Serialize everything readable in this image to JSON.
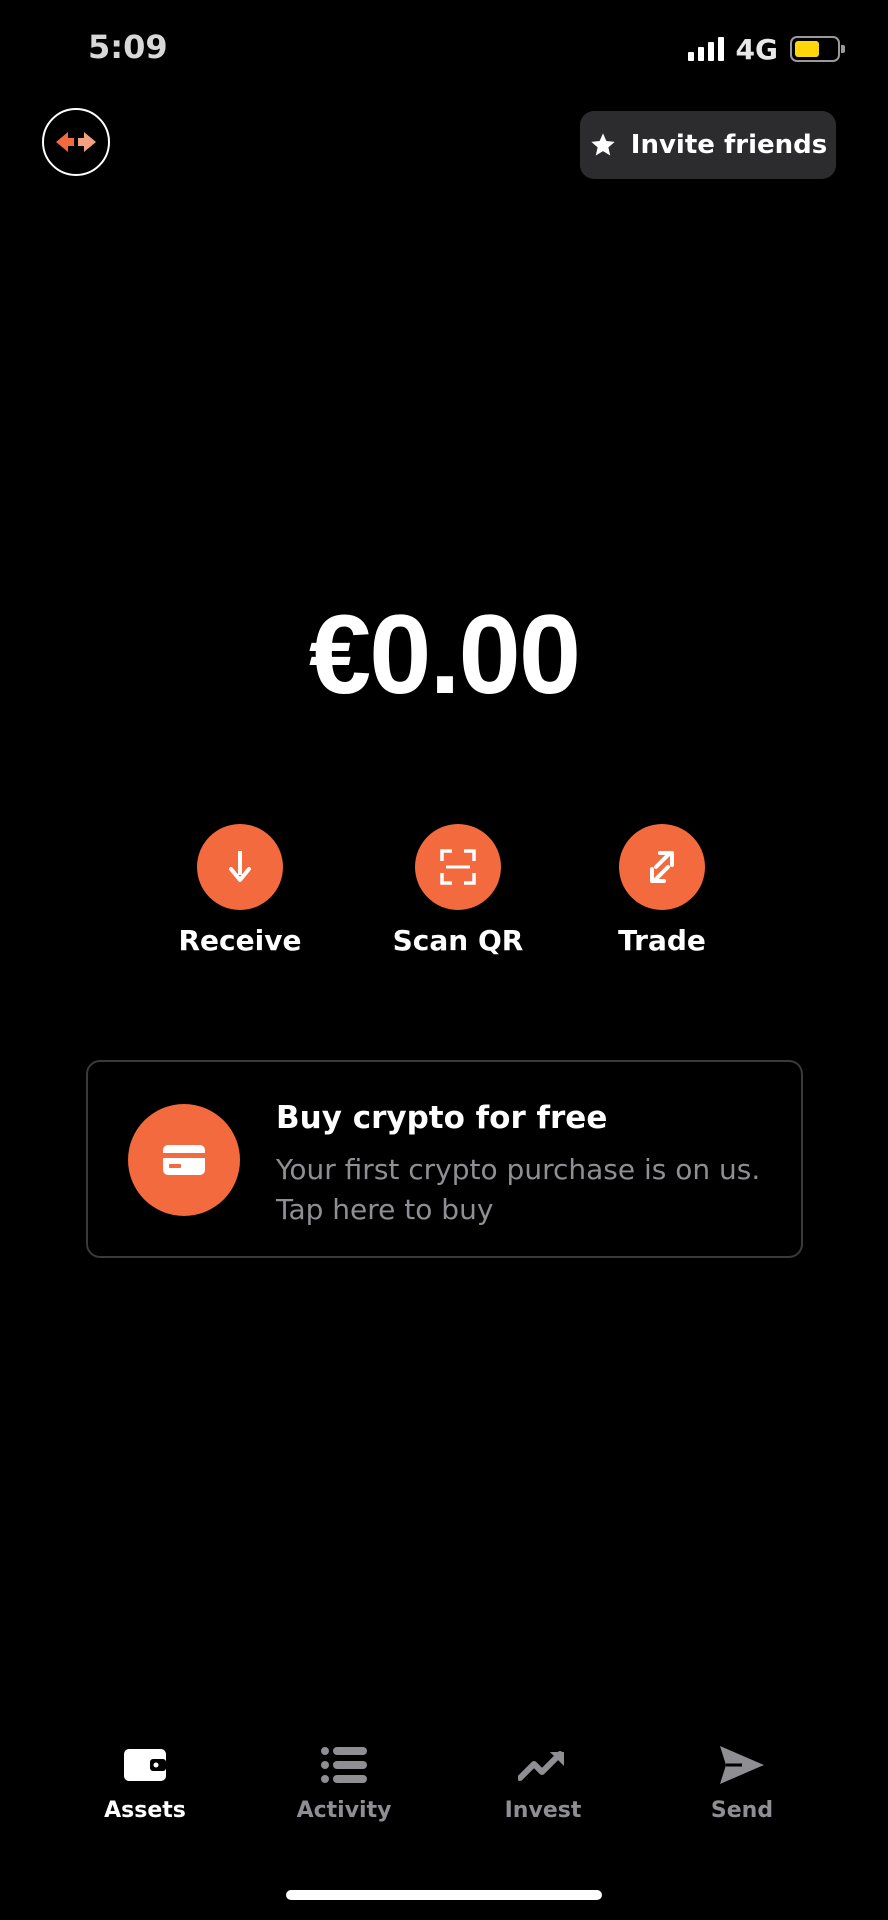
{
  "status_bar": {
    "time": "5:09",
    "network": "4G",
    "battery_level": 0.6,
    "icons": [
      "signal-icon",
      "battery-icon"
    ]
  },
  "header": {
    "left_icon": "swap-arrows-icon",
    "invite_label": "Invite friends",
    "invite_icon": "star-icon"
  },
  "balance": {
    "amount": "€0.00"
  },
  "actions": [
    {
      "label": "Receive",
      "icon": "arrow-down-icon"
    },
    {
      "label": "Scan QR",
      "icon": "qr-scan-icon"
    },
    {
      "label": "Trade",
      "icon": "trade-arrows-icon"
    }
  ],
  "promo": {
    "title": "Buy crypto for free",
    "text": "Your first crypto purchase is on us. Tap here to buy",
    "icon": "credit-card-icon"
  },
  "tabs": [
    {
      "label": "Assets",
      "icon": "wallet-icon",
      "active": true
    },
    {
      "label": "Activity",
      "icon": "list-icon",
      "active": false
    },
    {
      "label": "Invest",
      "icon": "trending-up-icon",
      "active": false
    },
    {
      "label": "Send",
      "icon": "send-icon",
      "active": false
    }
  ],
  "colors": {
    "accent": "#f26a3d",
    "background": "#000000",
    "card_border": "#3a3a3c",
    "muted_text": "#8e8e93",
    "invite_bg": "#2c2c2e"
  }
}
